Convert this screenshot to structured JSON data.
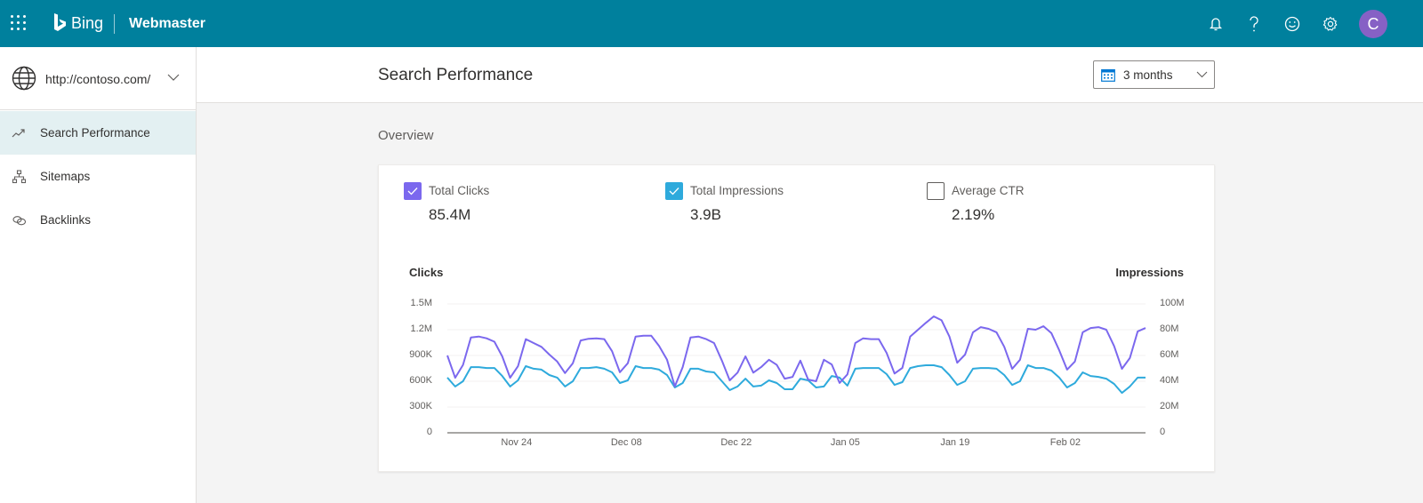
{
  "topbar": {
    "brand": "Bing",
    "product": "Webmaster",
    "avatar_initial": "C",
    "bg_color": "#00809d",
    "icons": [
      "waffle-icon",
      "bell-icon",
      "help-icon",
      "feedback-smiley-icon",
      "settings-gear-icon"
    ]
  },
  "sidebar": {
    "site_url": "http://contoso.com/",
    "items": [
      {
        "label": "Search Performance",
        "icon": "trend-icon",
        "active": true
      },
      {
        "label": "Sitemaps",
        "icon": "sitemap-icon",
        "active": false
      },
      {
        "label": "Backlinks",
        "icon": "link-icon",
        "active": false
      }
    ]
  },
  "header": {
    "title": "Search Performance",
    "date_range": "3 months"
  },
  "overview": {
    "label": "Overview",
    "metrics": [
      {
        "label": "Total Clicks",
        "value": "85.4M",
        "checked": true,
        "color": "#7b68ee"
      },
      {
        "label": "Total Impressions",
        "value": "3.9B",
        "checked": true,
        "color": "#2eaadc"
      },
      {
        "label": "Average CTR",
        "value": "2.19%",
        "checked": false,
        "color": "#605e5c"
      }
    ]
  },
  "chart_data": {
    "type": "line",
    "title": "",
    "xlabel": "",
    "ylabel": "Clicks",
    "y2label": "Impressions",
    "ylim": [
      0,
      1500000
    ],
    "y2lim": [
      0,
      100000000
    ],
    "yticks": [
      "0",
      "300K",
      "600K",
      "900K",
      "1.2M",
      "1.5M"
    ],
    "y2ticks": [
      "0",
      "20M",
      "40M",
      "60M",
      "80M",
      "100M"
    ],
    "x_start": "Nov 15",
    "x_end": "Feb 12",
    "xticks": [
      {
        "label": "Nov 24",
        "index": 9
      },
      {
        "label": "Dec 08",
        "index": 23
      },
      {
        "label": "Dec 22",
        "index": 37
      },
      {
        "label": "Jan 05",
        "index": 51
      },
      {
        "label": "Jan 19",
        "index": 65
      },
      {
        "label": "Feb 02",
        "index": 79
      }
    ],
    "grid": true,
    "series": [
      {
        "name": "Clicks",
        "axis": "left",
        "color": "#7b68ee",
        "values": [
          900000,
          640000,
          790000,
          1110000,
          1120000,
          1100000,
          1060000,
          890000,
          640000,
          775000,
          1090000,
          1045000,
          1000000,
          910000,
          830000,
          695000,
          810000,
          1075000,
          1095000,
          1100000,
          1090000,
          950000,
          705000,
          810000,
          1120000,
          1130000,
          1130000,
          1010000,
          850000,
          540000,
          765000,
          1110000,
          1120000,
          1090000,
          1045000,
          840000,
          610000,
          700000,
          890000,
          700000,
          765000,
          850000,
          790000,
          630000,
          650000,
          840000,
          620000,
          600000,
          850000,
          795000,
          580000,
          680000,
          1045000,
          1100000,
          1090000,
          1090000,
          930000,
          690000,
          755000,
          1120000,
          1200000,
          1280000,
          1355000,
          1310000,
          1120000,
          815000,
          910000,
          1170000,
          1230000,
          1210000,
          1170000,
          1000000,
          745000,
          850000,
          1210000,
          1200000,
          1240000,
          1160000,
          960000,
          735000,
          830000,
          1170000,
          1220000,
          1230000,
          1200000,
          1010000,
          745000,
          870000,
          1180000,
          1220000
        ]
      },
      {
        "name": "Impressions",
        "axis": "right",
        "color": "#2eaadc",
        "values": [
          42800000,
          35900000,
          40000000,
          51000000,
          51000000,
          50300000,
          50300000,
          44100000,
          35900000,
          40700000,
          51700000,
          49700000,
          49000000,
          44800000,
          42800000,
          35900000,
          40000000,
          50300000,
          50300000,
          51000000,
          49700000,
          46900000,
          38600000,
          40700000,
          51700000,
          50300000,
          50300000,
          49000000,
          44800000,
          35200000,
          38600000,
          49700000,
          49700000,
          47600000,
          46900000,
          40000000,
          33100000,
          35900000,
          42000000,
          35900000,
          36600000,
          40700000,
          38600000,
          33800000,
          33800000,
          42000000,
          40700000,
          35200000,
          35900000,
          44100000,
          42800000,
          36600000,
          49700000,
          50300000,
          50300000,
          50300000,
          45500000,
          37200000,
          39300000,
          50300000,
          51700000,
          52400000,
          52400000,
          51000000,
          44800000,
          37200000,
          40000000,
          49700000,
          50300000,
          50300000,
          49700000,
          44800000,
          37200000,
          40000000,
          52400000,
          50300000,
          50300000,
          48300000,
          42800000,
          35200000,
          38600000,
          46900000,
          44100000,
          43400000,
          42000000,
          37900000,
          31000000,
          35900000,
          42800000,
          42800000
        ]
      }
    ]
  }
}
